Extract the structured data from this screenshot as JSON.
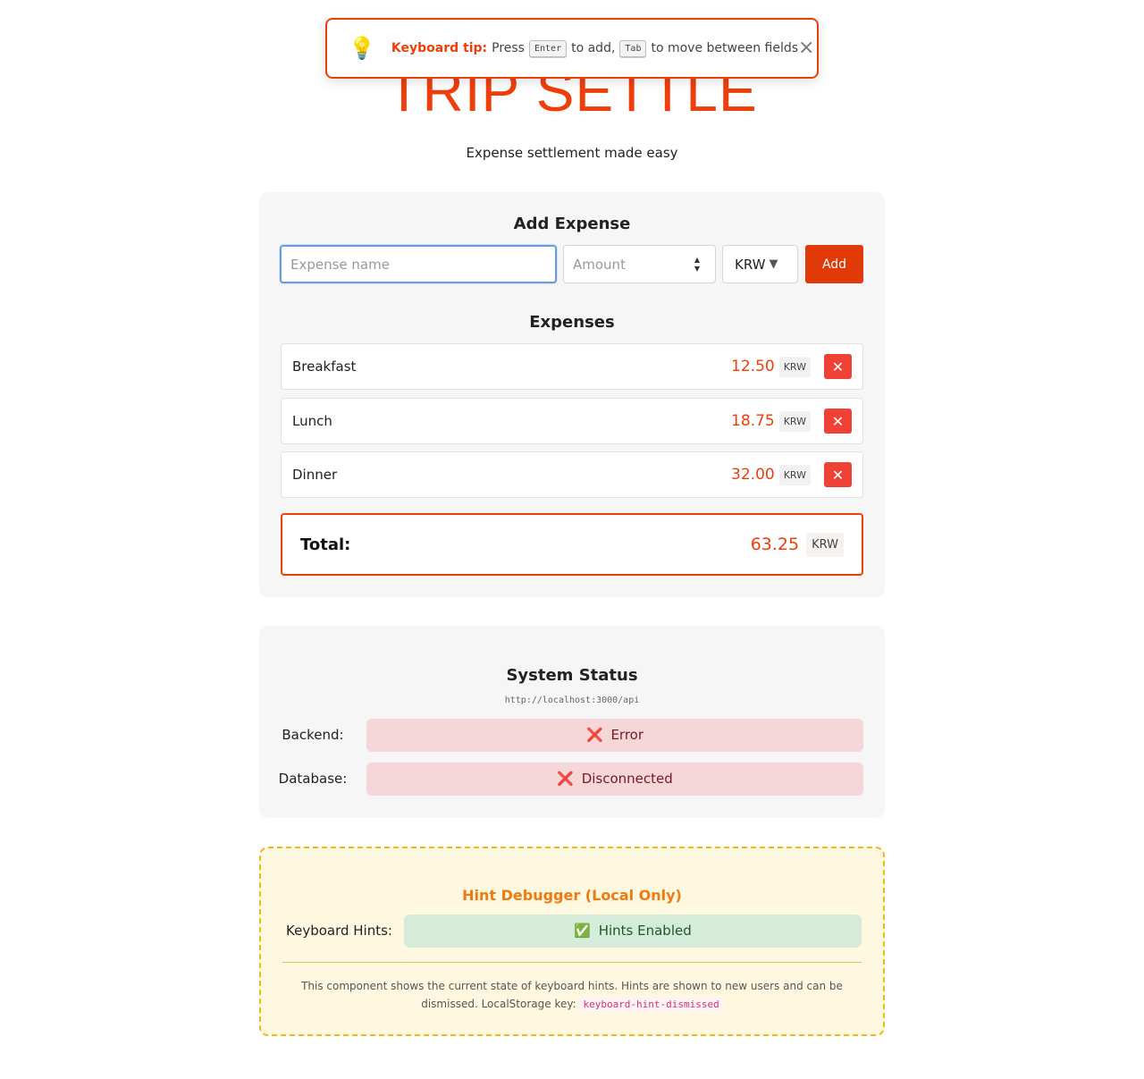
{
  "app": {
    "title": "TRIP SETTLE",
    "subtitle": "Expense settlement made easy"
  },
  "toast": {
    "icon": "lightbulb-icon",
    "emoji": "💡",
    "strong": "Keyboard tip:",
    "press": "Press",
    "key_enter": "Enter",
    "to_add": "to add,",
    "key_tab": "Tab",
    "to_move": "to move between fields",
    "close": "×"
  },
  "add_expense": {
    "title": "Add Expense",
    "name_placeholder": "Expense name",
    "amount_placeholder": "Amount",
    "currency": "KRW",
    "caret": "▼",
    "add_label": "Add"
  },
  "expenses": {
    "title": "Expenses",
    "items": [
      {
        "name": "Breakfast",
        "amount": "12.50",
        "currency": "KRW"
      },
      {
        "name": "Lunch",
        "amount": "18.75",
        "currency": "KRW"
      },
      {
        "name": "Dinner",
        "amount": "32.00",
        "currency": "KRW"
      }
    ],
    "delete_glyph": "✕",
    "total_label": "Total:",
    "total_amount": "63.25",
    "total_currency": "KRW"
  },
  "status": {
    "title": "System Status",
    "url": "http://localhost:3000/api",
    "backend_label": "Backend:",
    "backend_value": "Error",
    "database_label": "Database:",
    "database_value": "Disconnected",
    "error_glyph": "❌"
  },
  "debugger": {
    "title": "Hint Debugger (Local Only)",
    "hints_label": "Keyboard Hints:",
    "hints_value": "Hints Enabled",
    "ok_glyph": "✅",
    "description": "This component shows the current state of keyboard hints. Hints are shown to new users and can be dismissed. LocalStorage key:",
    "storage_key": "keyboard-hint-dismissed"
  },
  "colors": {
    "accent": "#ee3e0b",
    "delete": "#ef4136",
    "error_bg": "#f5d7d9",
    "ok_bg": "#d4ecd9",
    "debug_bg": "#fff8e1",
    "debug_border": "#f5b51f",
    "focus_border": "#6b9be0"
  }
}
